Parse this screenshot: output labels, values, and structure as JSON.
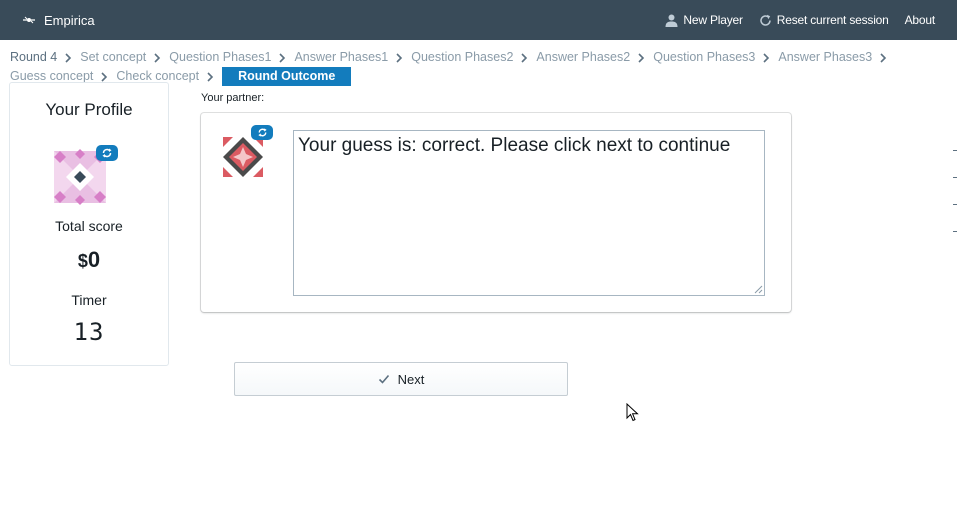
{
  "navbar": {
    "brand": "Empirica",
    "new_player": "New Player",
    "reset_session": "Reset current session",
    "about": "About"
  },
  "breadcrumbs": [
    {
      "label": "Round 4",
      "state": "done"
    },
    {
      "label": "Set concept",
      "state": "done"
    },
    {
      "label": "Question Phases1",
      "state": "done"
    },
    {
      "label": "Answer Phases1",
      "state": "done"
    },
    {
      "label": "Question Phases2",
      "state": "done"
    },
    {
      "label": "Answer Phases2",
      "state": "done"
    },
    {
      "label": "Question Phases3",
      "state": "done"
    },
    {
      "label": "Answer Phases3",
      "state": "done"
    },
    {
      "label": "Guess concept",
      "state": "done"
    },
    {
      "label": "Check concept",
      "state": "done"
    },
    {
      "label": "Round Outcome",
      "state": "current"
    }
  ],
  "profile": {
    "title": "Your Profile",
    "total_score_label": "Total score",
    "currency": "$",
    "score": "0",
    "timer_label": "Timer",
    "timer_value": "13"
  },
  "partner": {
    "label": "Your partner:",
    "message": "Your guess is: correct. Please click next to continue"
  },
  "next_button": {
    "label": "Next"
  },
  "colors": {
    "navbar": "#394b59",
    "accent": "#137cbd",
    "avatar_pink": "#d77fc7",
    "avatar_dark": "#394b59",
    "partner_red": "#db5b62"
  },
  "icons": {
    "brand": "empirica-logo-icon",
    "new_player": "person-icon",
    "reset": "refresh-icon",
    "next": "check-icon"
  }
}
